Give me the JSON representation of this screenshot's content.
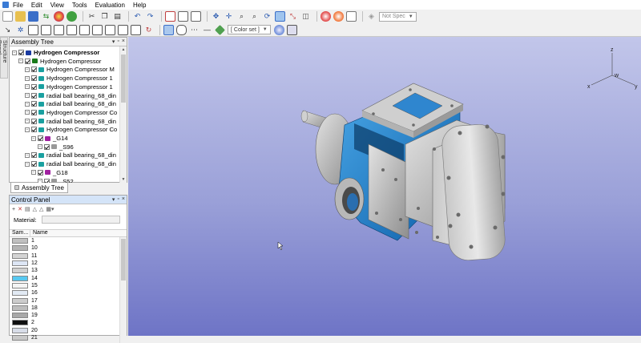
{
  "menu": [
    "File",
    "Edit",
    "View",
    "Tools",
    "Evaluation",
    "Help"
  ],
  "toolbar": {
    "spec_combo": "Not Spec",
    "color_combo": "[ Color set ]"
  },
  "side_tab": "Structure Panel",
  "assembly_tree": {
    "title": "Assembly Tree",
    "tab_label": "Assembly Tree",
    "rows": [
      {
        "label": "Hydrogen Compressor",
        "indent": 0,
        "bold": true,
        "icon": "#1a3aa0"
      },
      {
        "label": "Hydrogen Compressor",
        "indent": 1,
        "bold": false,
        "icon": "#1a7a1a"
      },
      {
        "label": "Hydrogen Compressor M",
        "indent": 2,
        "bold": false,
        "icon": "#1aa0a0"
      },
      {
        "label": "Hydrogen Compressor 1",
        "indent": 2,
        "bold": false,
        "icon": "#1aa0a0"
      },
      {
        "label": "Hydrogen Compressor 1",
        "indent": 2,
        "bold": false,
        "icon": "#1aa0a0"
      },
      {
        "label": "radial ball bearing_68_din",
        "indent": 2,
        "bold": false,
        "icon": "#1aa0a0"
      },
      {
        "label": "radial ball bearing_68_din",
        "indent": 2,
        "bold": false,
        "icon": "#1aa0a0"
      },
      {
        "label": "Hydrogen Compressor Co",
        "indent": 2,
        "bold": false,
        "icon": "#1aa0a0"
      },
      {
        "label": "radial ball bearing_68_din",
        "indent": 2,
        "bold": false,
        "icon": "#1aa0a0"
      },
      {
        "label": "Hydrogen Compressor Co",
        "indent": 2,
        "bold": false,
        "icon": "#1aa0a0"
      },
      {
        "label": "_G14",
        "indent": 3,
        "bold": false,
        "icon": "#a020a0"
      },
      {
        "label": "_S96",
        "indent": 4,
        "bold": false,
        "icon": "#999999"
      },
      {
        "label": "radial ball bearing_68_din",
        "indent": 2,
        "bold": false,
        "icon": "#1aa0a0"
      },
      {
        "label": "radial ball bearing_68_din",
        "indent": 2,
        "bold": false,
        "icon": "#1aa0a0"
      },
      {
        "label": "_G18",
        "indent": 3,
        "bold": false,
        "icon": "#a020a0"
      },
      {
        "label": "_S52",
        "indent": 4,
        "bold": false,
        "icon": "#999999"
      }
    ]
  },
  "control_panel": {
    "title": "Control Panel",
    "material_label": "Material:",
    "col_sample": "Sam...",
    "col_name": "Name",
    "rows": [
      {
        "name": "1",
        "color": "#c0c0c0"
      },
      {
        "name": "10",
        "color": "#b4b4b4"
      },
      {
        "name": "11",
        "color": "#d4d4d4"
      },
      {
        "name": "12",
        "color": "#dde6f5"
      },
      {
        "name": "13",
        "color": "#d0d0d0"
      },
      {
        "name": "14",
        "color": "#58c8f0"
      },
      {
        "name": "15",
        "color": "#f4f4f4"
      },
      {
        "name": "16",
        "color": "#e2eaf4"
      },
      {
        "name": "17",
        "color": "#cccccc"
      },
      {
        "name": "18",
        "color": "#bdbdbd"
      },
      {
        "name": "19",
        "color": "#a8a8a8"
      },
      {
        "name": "2",
        "color": "#101010"
      },
      {
        "name": "20",
        "color": "#d8dde8"
      },
      {
        "name": "21",
        "color": "#c8c8c8"
      }
    ]
  },
  "triad": {
    "x": "x",
    "y": "y",
    "z": "z",
    "w": "w"
  },
  "colors": {
    "accent_blue": "#1f7fc6",
    "housing_gray": "#b8b8b8"
  }
}
